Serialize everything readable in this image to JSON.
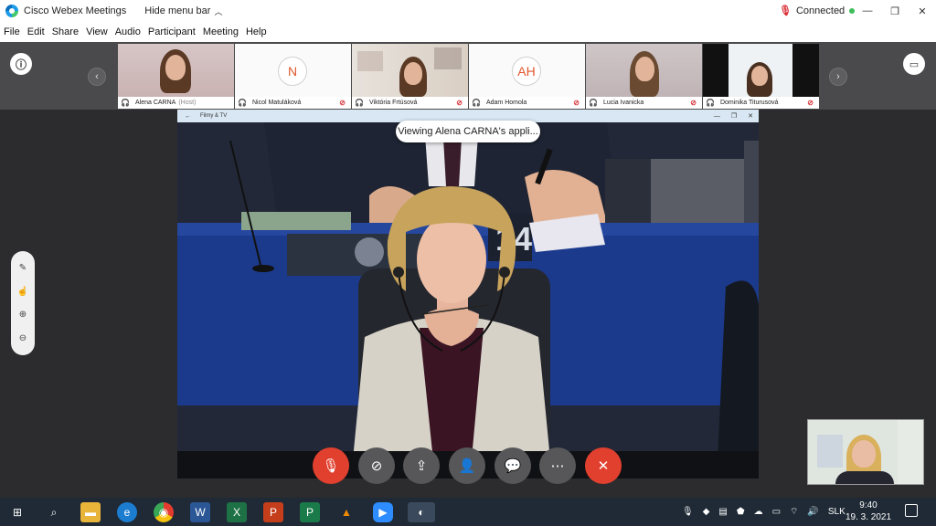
{
  "window": {
    "title": "Cisco Webex Meetings",
    "hide_menu": "Hide menu bar",
    "status": "Connected",
    "status_color": "#3ebd5a"
  },
  "menu": [
    "File",
    "Edit",
    "Share",
    "View",
    "Audio",
    "Participant",
    "Meeting",
    "Help"
  ],
  "participants": [
    {
      "name": "Alena CARNA",
      "role": "(Host)",
      "initials": "",
      "active": true
    },
    {
      "name": "Nicol Matuláková",
      "role": "",
      "initials": "N",
      "active": false
    },
    {
      "name": "Viktória Frtúsová",
      "role": "",
      "initials": "",
      "active": false
    },
    {
      "name": "Adam Homola",
      "role": "",
      "initials": "AH",
      "active": false
    },
    {
      "name": "Lucia Ivanicka",
      "role": "",
      "initials": "",
      "active": false
    },
    {
      "name": "Dominika Titurusová",
      "role": "",
      "initials": "",
      "active": false
    }
  ],
  "shared_window": {
    "title": "Filmy & TV",
    "viewing": "Viewing Alena CARNA's appli...",
    "seat_number": "14"
  },
  "controls": [
    "mute",
    "stop-video",
    "share",
    "participants",
    "chat",
    "more",
    "leave"
  ],
  "taskbar": {
    "language": "SLK",
    "time": "9:40",
    "date": "19. 3. 2021"
  },
  "colors": {
    "accent": "#1aa1e6",
    "leave": "#e2402f",
    "mute": "#e2402f"
  }
}
